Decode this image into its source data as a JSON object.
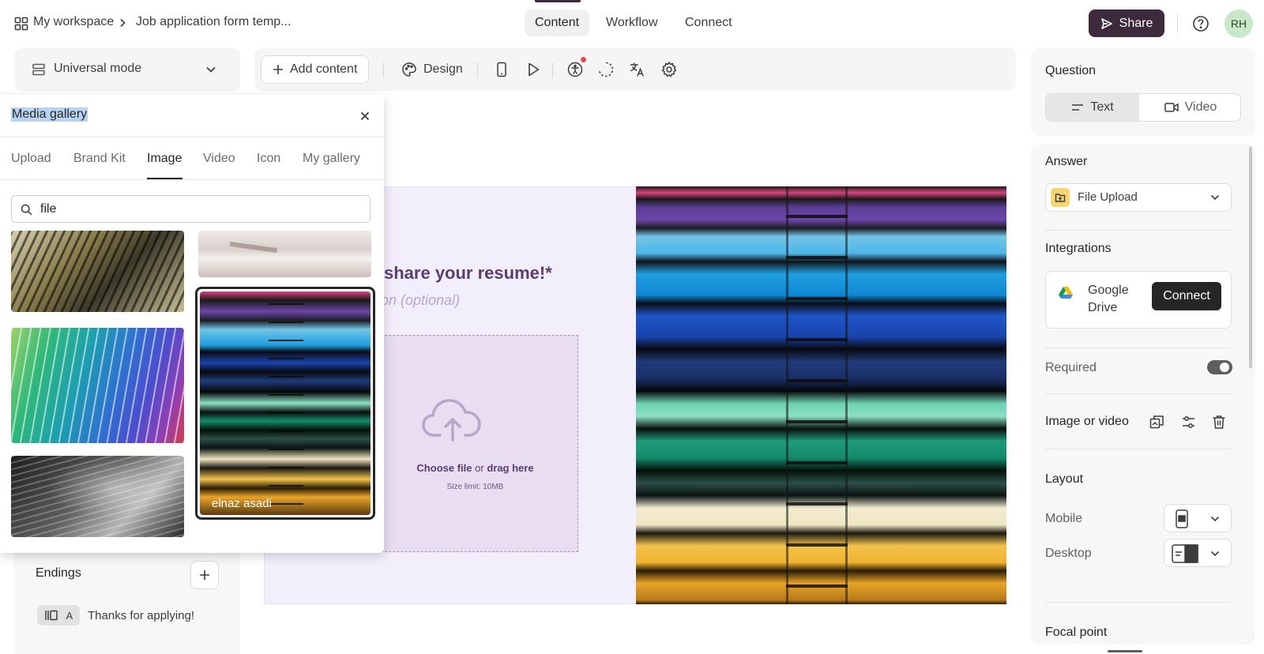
{
  "topbar": {
    "breadcrumb_root": "My workspace",
    "breadcrumb_page": "Job application form temp...",
    "tabs": [
      "Content",
      "Workflow",
      "Connect"
    ],
    "active_tab": "Content",
    "share_label": "Share",
    "avatar_initials": "RH"
  },
  "left": {
    "mode_label": "Universal mode",
    "endings_label": "Endings",
    "ending_item_letter": "A",
    "ending_item_text": "Thanks for applying!"
  },
  "toolbar": {
    "add_content_label": "Add content",
    "design_label": "Design"
  },
  "media_gallery": {
    "title": "Media gallery",
    "tabs": [
      "Upload",
      "Brand Kit",
      "Image",
      "Video",
      "Icon",
      "My gallery"
    ],
    "active_tab": "Image",
    "search_value": "file",
    "selected_author": "elnaz asadi"
  },
  "canvas": {
    "question_text": "share your resume!*",
    "description_placeholder": "on (optional)",
    "upload_choose": "Choose file",
    "upload_or": "or",
    "upload_drag": "drag here",
    "upload_limit": "Size limit: 10MB"
  },
  "right_panel": {
    "question_header": "Question",
    "q_text_label": "Text",
    "q_video_label": "Video",
    "answer_header": "Answer",
    "answer_type": "File Upload",
    "integrations_header": "Integrations",
    "integration_name_line1": "Google",
    "integration_name_line2": "Drive",
    "connect_label": "Connect",
    "required_label": "Required",
    "required_on": true,
    "image_or_video_label": "Image or video",
    "layout_header": "Layout",
    "mobile_label": "Mobile",
    "desktop_label": "Desktop",
    "focal_point_label": "Focal point"
  },
  "colors": {
    "brand_dark": "#3d2b3d",
    "canvas_bg": "#f3eefb",
    "question_color": "#5b3e70",
    "notification_dot": "#e5484d"
  }
}
